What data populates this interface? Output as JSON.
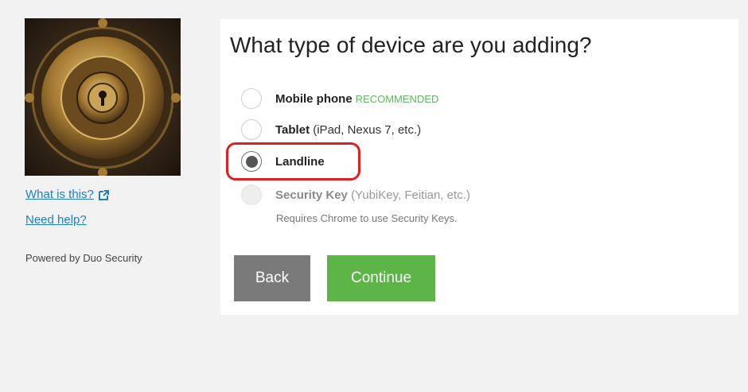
{
  "sidebar": {
    "logo_alt": "Lehigh University",
    "what_is_this": "What is this?",
    "need_help": "Need help?",
    "powered_by": "Powered by Duo Security"
  },
  "panel": {
    "title": "What type of device are you adding?",
    "options": [
      {
        "label": "Mobile phone",
        "detail": "",
        "badge": "RECOMMENDED",
        "selected": false,
        "disabled": false
      },
      {
        "label": "Tablet",
        "detail": "(iPad, Nexus 7, etc.)",
        "badge": "",
        "selected": false,
        "disabled": false
      },
      {
        "label": "Landline",
        "detail": "",
        "badge": "",
        "selected": true,
        "disabled": false
      },
      {
        "label": "Security Key",
        "detail": "(YubiKey, Feitian, etc.)",
        "badge": "",
        "selected": false,
        "disabled": true
      }
    ],
    "security_key_note": "Requires Chrome to use Security Keys.",
    "buttons": {
      "back": "Back",
      "continue": "Continue"
    }
  },
  "colors": {
    "accent_green": "#5cb546",
    "recommended_green": "#5cb85c",
    "link_blue": "#1f7dc9",
    "highlight_red": "#e02020",
    "back_gray": "#7a7a7a"
  },
  "icons": {
    "external_link": "external-link-icon"
  }
}
